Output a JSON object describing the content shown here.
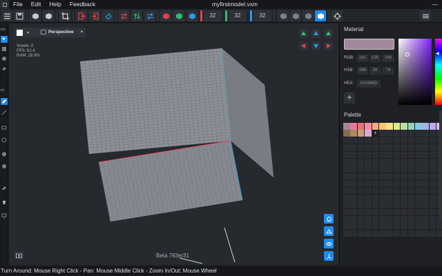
{
  "menu": {
    "items": [
      "File",
      "Edit",
      "Help",
      "Feedback"
    ]
  },
  "window": {
    "title": "myfirstmodel.vxm"
  },
  "toolbar": {
    "size_x": "32",
    "size_y": "32",
    "size_z": "32",
    "axis_colors": {
      "x": "#e0434d",
      "y": "#2fbf71",
      "z": "#2f9be0"
    }
  },
  "left_tools": {
    "labels": [
      "ode",
      "ols"
    ]
  },
  "viewport": {
    "view_mode": "Perspective",
    "stats": {
      "voxels": "Voxels: 0",
      "fps": "FPS: 61.4",
      "ram": "RAM: 28.9%"
    },
    "version": "Beta 783er31"
  },
  "material": {
    "title": "Material",
    "color": "#a1889d",
    "rgb_label": "RGB:",
    "rgb": [
      "161",
      "136",
      "169"
    ],
    "hsb_label": "HSB:",
    "hsb": [
      "268",
      "28",
      "74"
    ],
    "hex_label": "HEX:",
    "hex": "#A1888D"
  },
  "palette": {
    "title": "Palette",
    "colors": [
      "#a1889d",
      "#e67a9a",
      "#e57373",
      "#f08fa0",
      "#f5a97f",
      "#f7c873",
      "#fbe08a",
      "#dbe98e",
      "#b8e0a0",
      "#8fd4b8",
      "#85c8e0",
      "#9fb4e8",
      "#c0a8e8",
      "#d6b8f0",
      "#8a6a50",
      "#b08860",
      "#c8a078",
      "#e0a8d8"
    ]
  },
  "status": {
    "hint": "Turn Around: Mouse Right Click - Pan: Mouse Middle Click - Zoom In/Out: Mouse Wheel"
  }
}
